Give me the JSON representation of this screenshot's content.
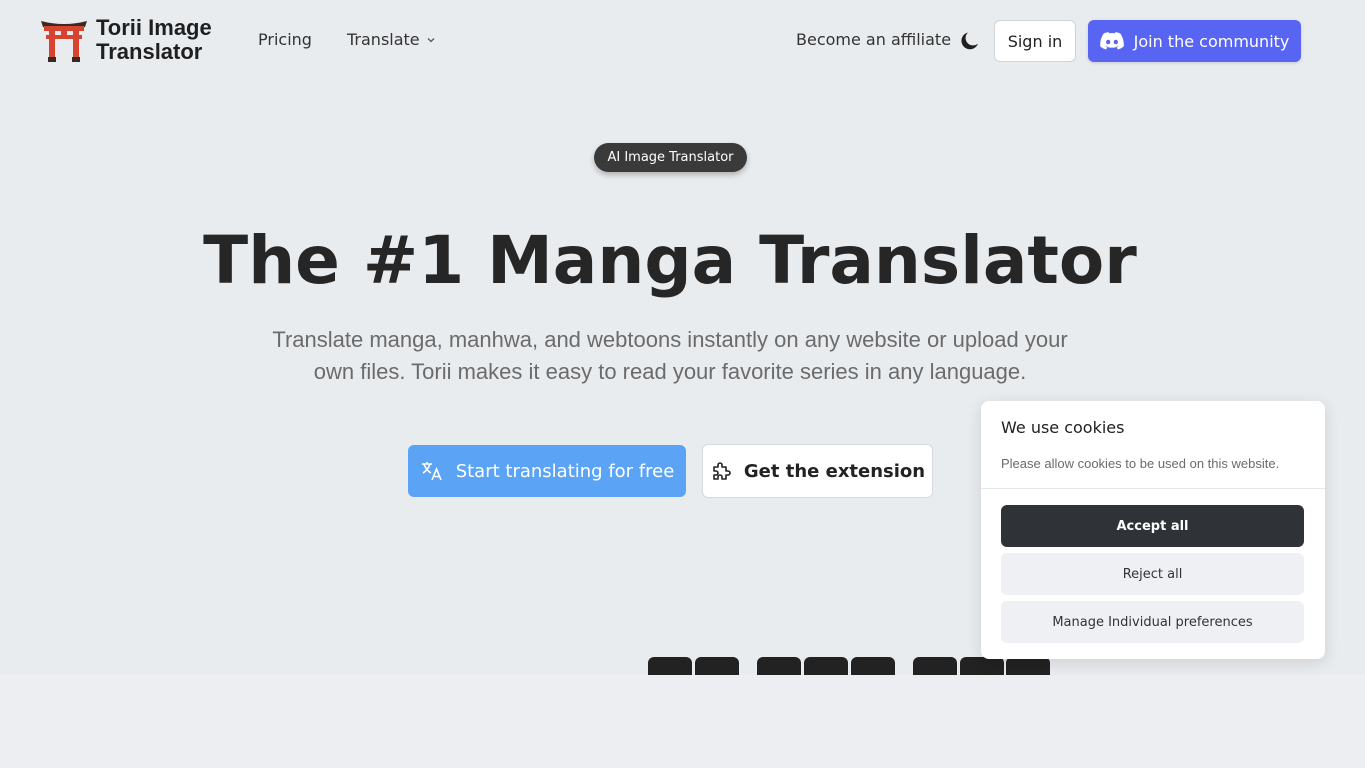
{
  "header": {
    "logo_line1": "Torii Image",
    "logo_line2": "Translator",
    "nav": {
      "pricing": "Pricing",
      "translate": "Translate",
      "affiliate": "Become an affiliate"
    },
    "sign_in": "Sign in",
    "join_community": "Join the community"
  },
  "hero": {
    "badge": "AI Image Translator",
    "title": "The #1 Manga Translator",
    "subtitle_line1": "Translate manga, manhwa, and webtoons instantly on any website or upload your",
    "subtitle_line2": "own files. Torii makes it easy to read your favorite series in any language.",
    "start_button": "Start translating for free",
    "extension_button": "Get the extension"
  },
  "cookie": {
    "title": "We use cookies",
    "description": "Please allow cookies to be used on this website.",
    "accept": "Accept all",
    "reject": "Reject all",
    "manage": "Manage Individual preferences"
  },
  "colors": {
    "background": "#e9ecef",
    "discord": "#5865f2",
    "primary": "#5ba4f5",
    "torii_red": "#d8432f"
  }
}
